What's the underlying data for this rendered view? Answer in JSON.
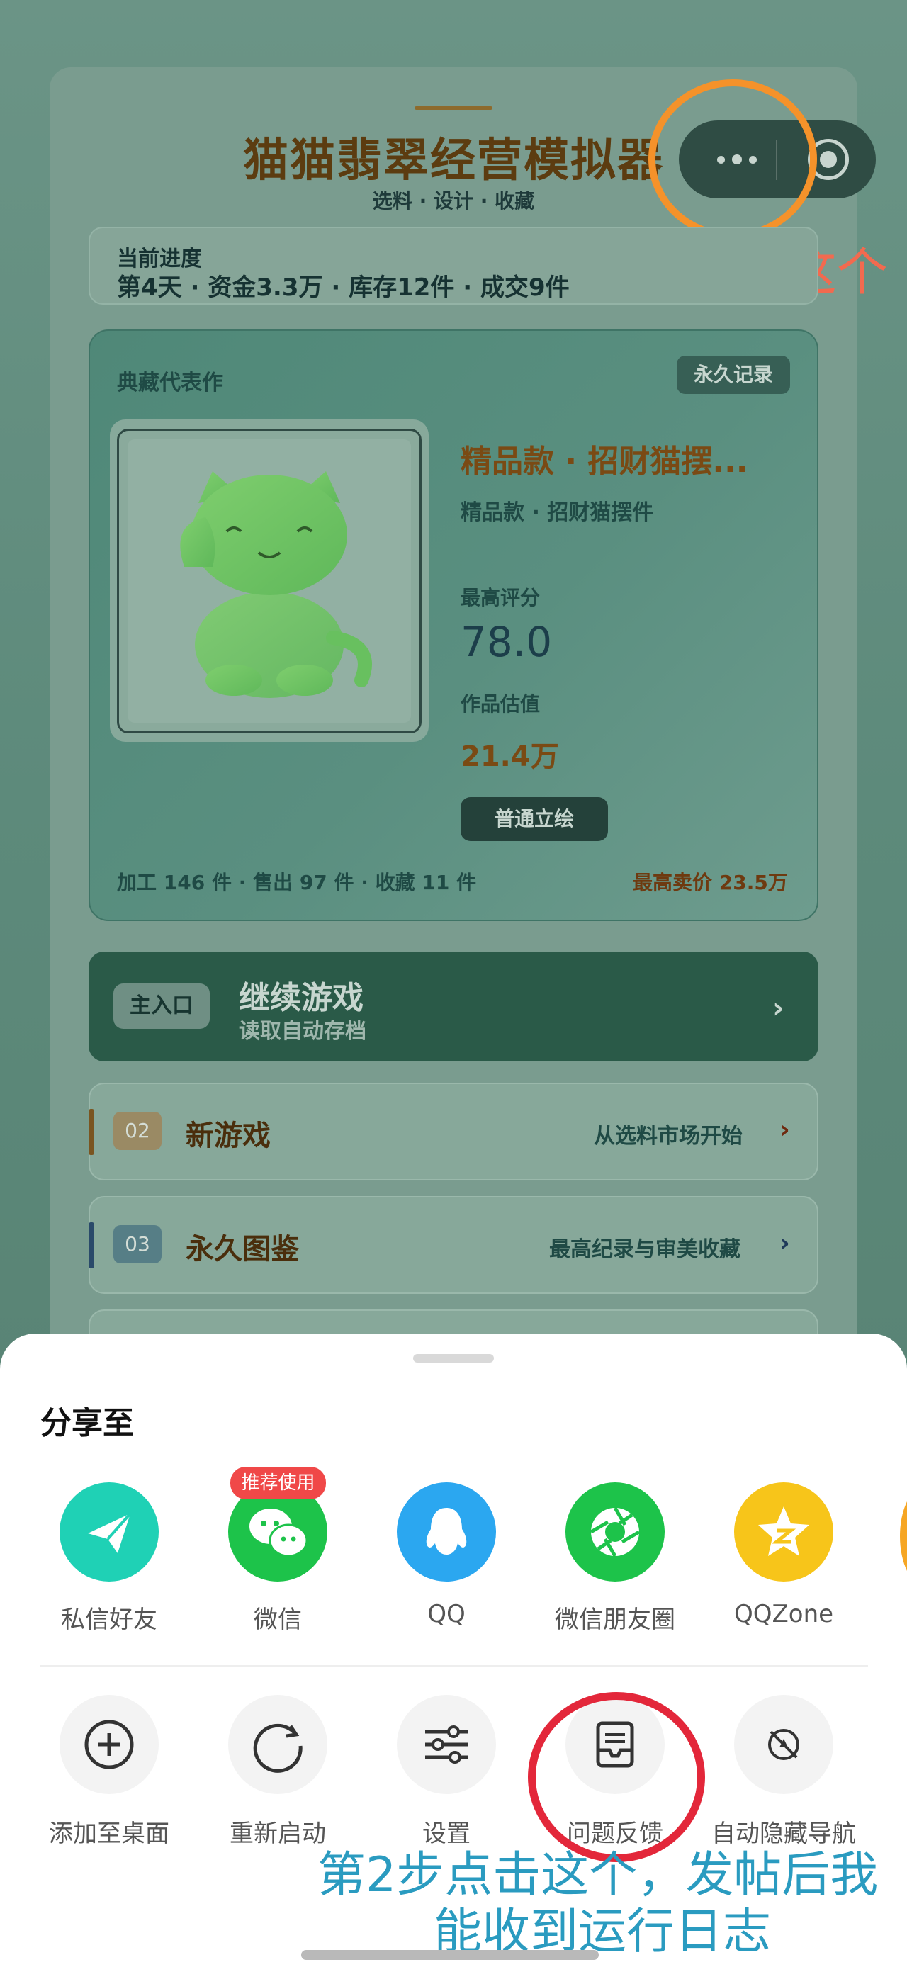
{
  "game": {
    "title": "猫猫翡翠经营模拟器",
    "subtitle": "选料 · 设计 · 收藏"
  },
  "capsule": {
    "more_icon": "more-dots-icon",
    "close_icon": "target-close-icon"
  },
  "progress": {
    "label": "当前进度",
    "text": "第4天 · 资金3.3万 · 库存12件 · 成交9件"
  },
  "collection": {
    "label": "典藏代表作",
    "badge": "永久记录",
    "work_title": "精品款 · 招财猫摆...",
    "work_subtitle": "精品款 · 招财猫摆件",
    "score_label": "最高评分",
    "score_value": "78.0",
    "estimate_label": "作品估值",
    "estimate_value": "21.4万",
    "portrait_button": "普通立绘",
    "stats_left": "加工 146 件 · 售出 97 件 · 收藏 11 件",
    "stats_right": "最高卖价 23.5万"
  },
  "continue": {
    "badge": "主入口",
    "title": "继续游戏",
    "subtitle": "读取自动存档",
    "chevron": "›"
  },
  "menu_rows": [
    {
      "num": "02",
      "title": "新游戏",
      "desc": "从选料市场开始",
      "chevron": "›"
    },
    {
      "num": "03",
      "title": "永久图鉴",
      "desc": "最高纪录与审美收藏",
      "chevron": "›"
    }
  ],
  "sheet": {
    "title": "分享至",
    "recommend_badge": "推荐使用",
    "share_items": [
      {
        "label": "私信好友",
        "icon": "paper-plane-icon",
        "color": "#1fd1b5"
      },
      {
        "label": "微信",
        "icon": "wechat-icon",
        "color": "#1dc34a"
      },
      {
        "label": "QQ",
        "icon": "qq-penguin-icon",
        "color": "#2ba7f0"
      },
      {
        "label": "微信朋友圈",
        "icon": "moments-aperture-icon",
        "color": "#1dc34a"
      },
      {
        "label": "QQZone",
        "icon": "qzone-star-icon",
        "color": "#f7c51a"
      }
    ],
    "actions": [
      {
        "label": "添加至桌面",
        "icon": "add-circle-icon"
      },
      {
        "label": "重新启动",
        "icon": "restart-icon"
      },
      {
        "label": "设置",
        "icon": "sliders-icon"
      },
      {
        "label": "问题反馈",
        "icon": "feedback-inbox-icon"
      },
      {
        "label": "自动隐藏导航",
        "icon": "hide-nav-icon"
      }
    ]
  },
  "annotations": {
    "step1": "第1步点击这个",
    "step2_line1": "第2步点击这个，发帖后我",
    "step2_line2": "能收到运行日志"
  }
}
